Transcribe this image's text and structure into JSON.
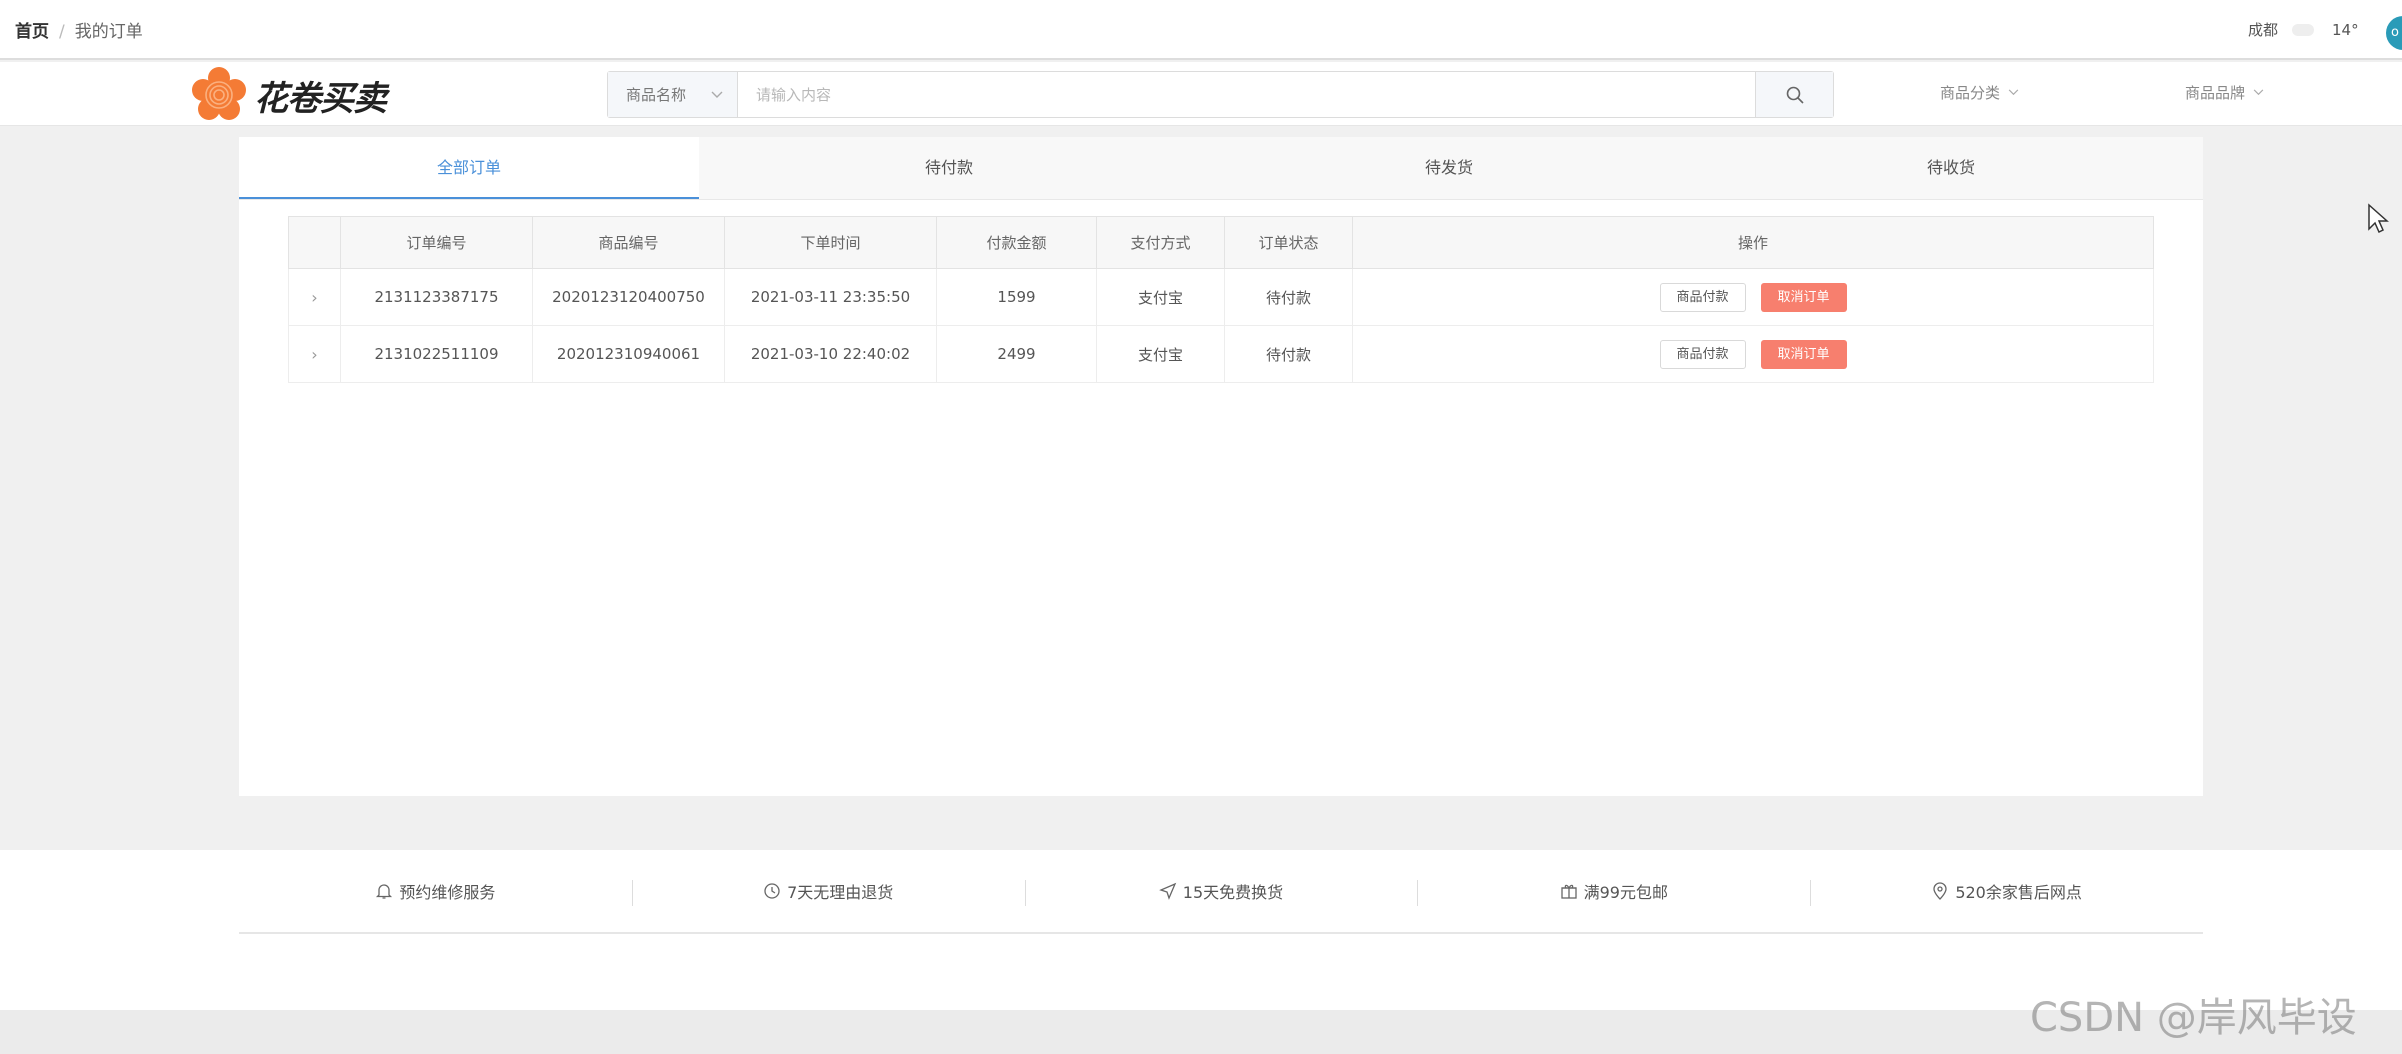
{
  "breadcrumb": {
    "home": "首页",
    "separator": "/",
    "current": "我的订单"
  },
  "weather": {
    "city": "成都",
    "temp": "14°"
  },
  "avatar": {
    "initial": "o"
  },
  "logo": {
    "text": "花卷买卖",
    "color": "#f47b35"
  },
  "search": {
    "category": "商品名称",
    "placeholder": "请输入内容"
  },
  "nav": {
    "category": "商品分类",
    "brand": "商品品牌"
  },
  "tabs": [
    "全部订单",
    "待付款",
    "待发货",
    "待收货"
  ],
  "table": {
    "headers": [
      "订单编号",
      "商品编号",
      "下单时间",
      "付款金额",
      "支付方式",
      "订单状态",
      "操作"
    ],
    "rows": [
      {
        "order_no": "2131123387175",
        "product_no": "2020123120400750",
        "time": "2021-03-11 23:35:50",
        "amount": "1599",
        "payment": "支付宝",
        "status": "待付款",
        "pay_label": "商品付款",
        "cancel_label": "取消订单"
      },
      {
        "order_no": "2131022511109",
        "product_no": "202012310940061",
        "time": "2021-03-10 22:40:02",
        "amount": "2499",
        "payment": "支付宝",
        "status": "待付款",
        "pay_label": "商品付款",
        "cancel_label": "取消订单"
      }
    ]
  },
  "services": [
    {
      "icon": "bell-icon",
      "label": "预约维修服务"
    },
    {
      "icon": "clock-icon",
      "label": "7天无理由退货"
    },
    {
      "icon": "send-icon",
      "label": "15天免费换货"
    },
    {
      "icon": "gift-icon",
      "label": "满99元包邮"
    },
    {
      "icon": "location-icon",
      "label": "520余家售后网点"
    }
  ],
  "watermark": "CSDN @岸风毕设",
  "colors": {
    "accent": "#4a90d9",
    "cancel": "#f77f6e"
  }
}
